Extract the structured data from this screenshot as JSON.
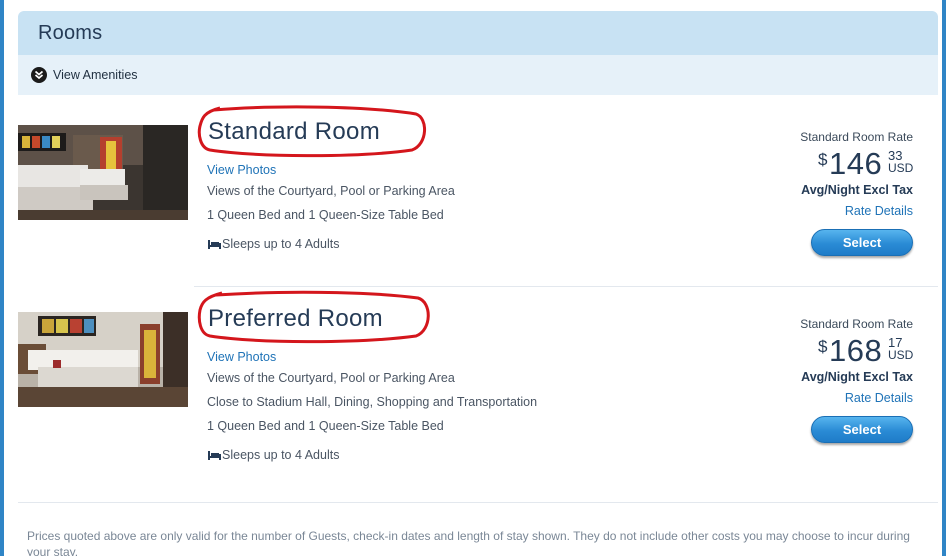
{
  "header": {
    "title": "Rooms"
  },
  "amenities": {
    "label": "View Amenities",
    "icon": "chevron-down-circle-icon"
  },
  "rooms": [
    {
      "name": "Standard Room",
      "view_photos": "View Photos",
      "details": [
        "Views of the Courtyard, Pool or Parking Area",
        "1 Queen Bed and 1 Queen-Size Table Bed"
      ],
      "sleeps": "Sleeps up to 4 Adults",
      "rate_label": "Standard Room Rate",
      "currency": "$",
      "price_dollars": "146",
      "price_cents": "33",
      "price_unit": "USD",
      "avg_note": "Avg/Night Excl Tax",
      "rate_details": "Rate Details",
      "select_label": "Select"
    },
    {
      "name": "Preferred Room",
      "view_photos": "View Photos",
      "details": [
        "Views of the Courtyard, Pool or Parking Area",
        "Close to Stadium Hall, Dining, Shopping and Transportation",
        "1 Queen Bed and 1 Queen-Size Table Bed"
      ],
      "sleeps": "Sleeps up to 4 Adults",
      "rate_label": "Standard Room Rate",
      "currency": "$",
      "price_dollars": "168",
      "price_cents": "17",
      "price_unit": "USD",
      "avg_note": "Avg/Night Excl Tax",
      "rate_details": "Rate Details",
      "select_label": "Select"
    }
  ],
  "disclaimer": "Prices quoted above are only valid for the number of Guests, check-in dates and length of stay shown. They do not include other costs you may choose to incur during your stay.",
  "colors": {
    "accent": "#2f85c6",
    "header_bg": "#c8e2f3",
    "link": "#1f73b7",
    "annotation_red": "#d4161c"
  }
}
